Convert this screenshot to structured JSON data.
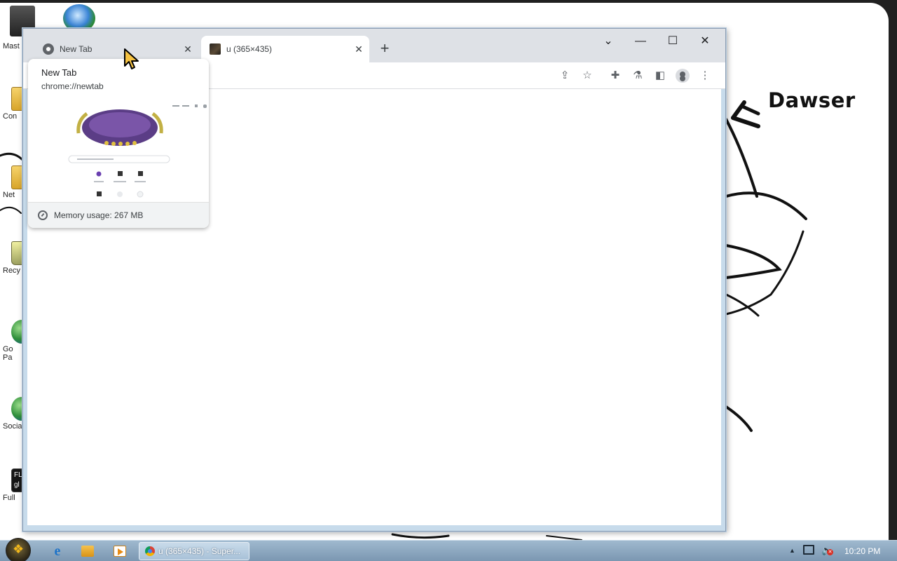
{
  "desktop": {
    "icon_captions": [
      "Mast",
      "Con",
      "Net",
      "Recy",
      "Go\nPa",
      "Socia",
      "Full"
    ],
    "fl_icon_text": "FL\ngl",
    "wallpaper_text": "Dawser"
  },
  "browser": {
    "tabs": [
      {
        "title": "New Tab",
        "favicon": "chrome-icon",
        "active": false
      },
      {
        "title": "u (365×435)",
        "favicon": "image-thumbnail-icon",
        "active": true
      }
    ],
    "new_tab_symbol": "+",
    "close_symbol": "✕",
    "window_controls": {
      "tab_search": "⌄",
      "minimize": "—",
      "maximize": "☐",
      "close": "✕"
    },
    "toolbar_icons": [
      "share-icon",
      "star-icon",
      "puzzle-icon",
      "flask-icon",
      "side-panel-icon",
      "profile-icon",
      "kebab-menu-icon"
    ],
    "toolbar_glyphs": {
      "share": "⇪",
      "bookmark": "☆",
      "extensions": "✚",
      "labs": "⚗",
      "side_panel": "◧",
      "menu": "⋮"
    }
  },
  "hover_card": {
    "title": "New Tab",
    "url": "chrome://newtab",
    "memory_usage": "Memory usage: 267 MB"
  },
  "taskbar": {
    "active_task": "u (365×435) - Super...",
    "ie_glyph": "e",
    "tray_arrow": "▲",
    "volume_glyph": "🔈",
    "volume_muted_glyph": "✕",
    "clock": "10:20 PM"
  },
  "colors": {
    "tab_strip": "#dee1e6",
    "active_tab": "#ffffff",
    "taskbar": "#8aa6bf",
    "window_border": "#c7dbeb"
  }
}
